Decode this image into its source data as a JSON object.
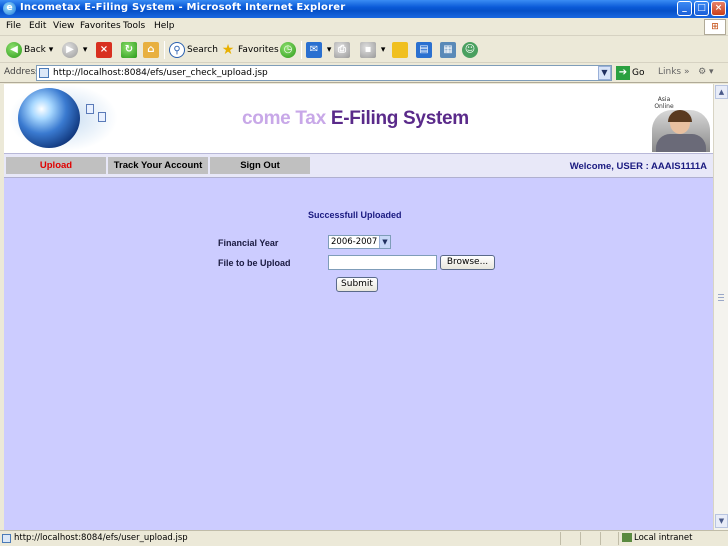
{
  "window": {
    "title": "Incometax E-Filing System - Microsoft Internet Explorer",
    "controls": [
      "_",
      "□",
      "×"
    ]
  },
  "menu": [
    "File",
    "Edit",
    "View",
    "Favorites",
    "Tools",
    "Help"
  ],
  "toolbar": {
    "back_label": "Back",
    "search_label": "Search",
    "favorites_label": "Favorites"
  },
  "address": {
    "label": "Address",
    "url": "http://localhost:8084/efs/user_check_upload.jsp",
    "go_label": "Go",
    "links_label": "Links"
  },
  "banner": {
    "title_faded": "come Tax ",
    "title_main": "E-Filing System",
    "badge_text": "Asia Online"
  },
  "nav": {
    "items": [
      {
        "label": "Upload",
        "active": true
      },
      {
        "label": "Track Your Account",
        "active": false
      },
      {
        "label": "Sign Out",
        "active": false
      }
    ],
    "welcome": "Welcome, USER : AAAIS1111A"
  },
  "form": {
    "message": "Successfull Uploaded",
    "financial_year_label": "Financial Year",
    "financial_year_value": "2006-2007",
    "file_label": "File to be Upload",
    "browse_label": "Browse...",
    "submit_label": "Submit"
  },
  "status": {
    "text": "http://localhost:8084/efs/user_upload.jsp",
    "zone": "Local intranet"
  },
  "colors": {
    "page_background": "#ccccff",
    "nav_active": "#e00000",
    "nav_button": "#c0c0c0",
    "heading_text": "#1a1a80",
    "banner_title": "#5a2a8a"
  }
}
